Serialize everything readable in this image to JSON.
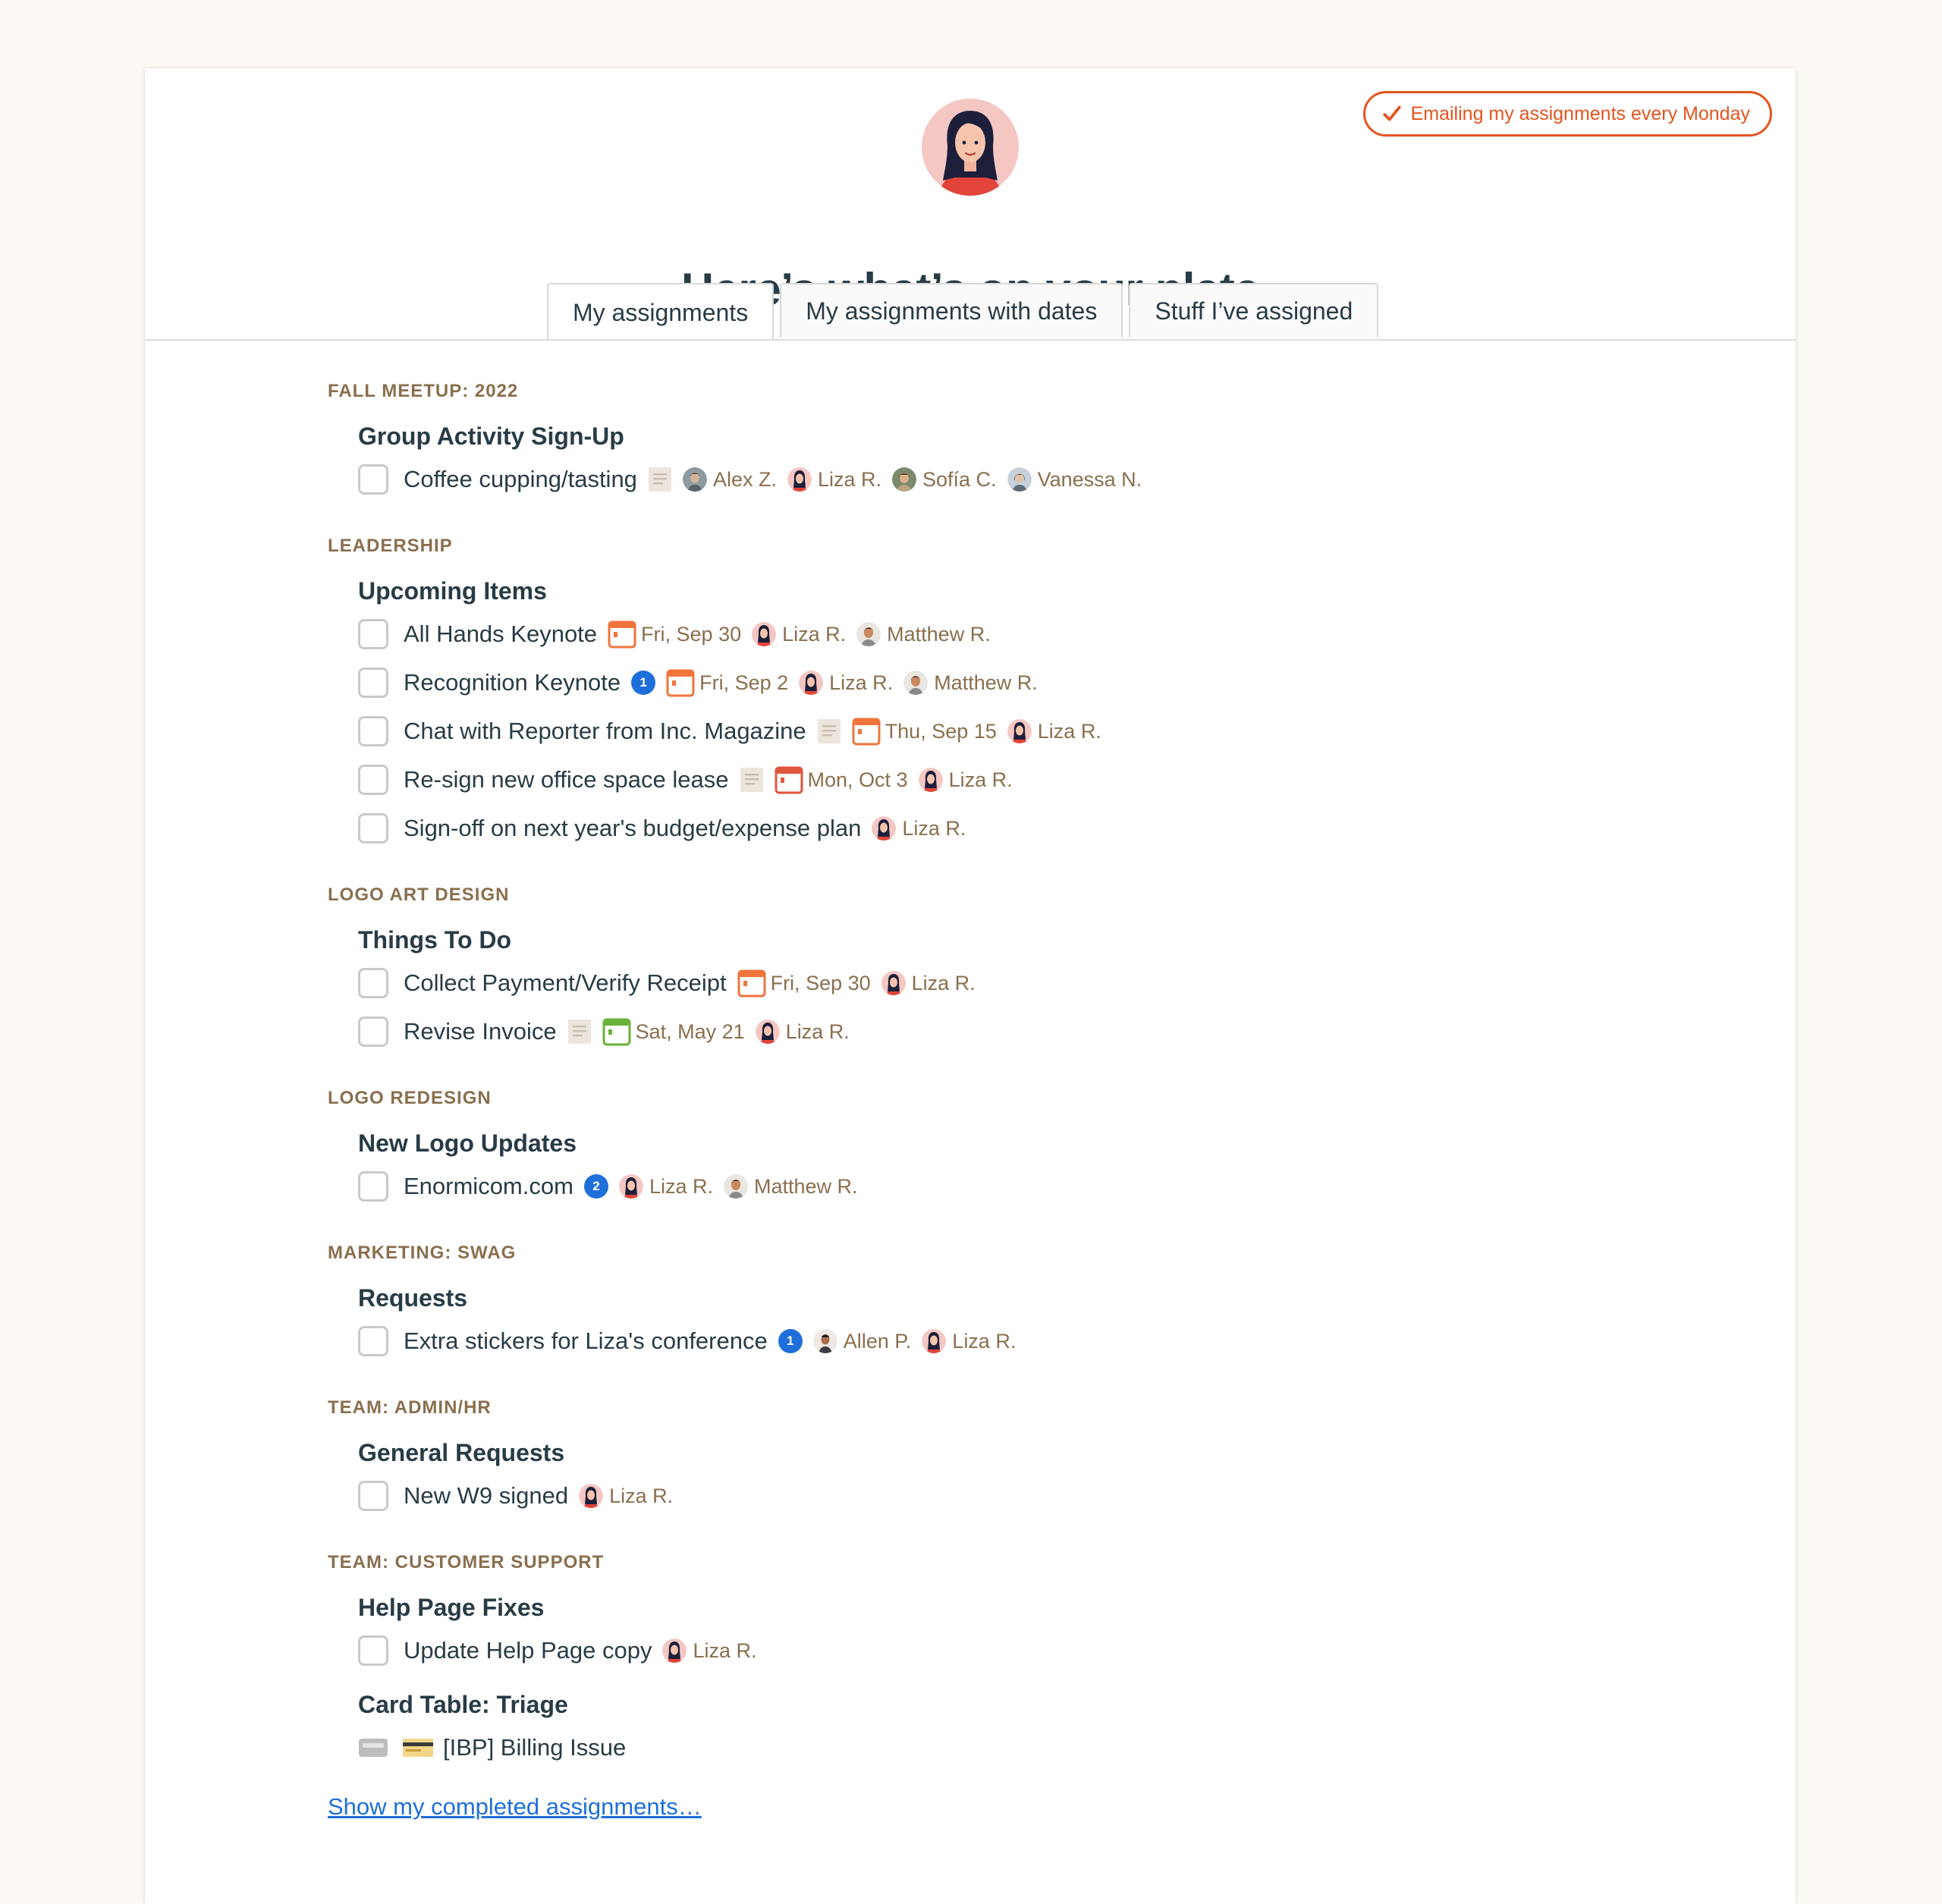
{
  "header": {
    "email_toggle_label": "Emailing my assignments every Monday",
    "title": "Here’s what’s on your plate"
  },
  "tabs": [
    {
      "label": "My assignments",
      "active": true
    },
    {
      "label": "My assignments with dates",
      "active": false
    },
    {
      "label": "Stuff I’ve assigned",
      "active": false
    }
  ],
  "buckets": [
    {
      "name": "FALL MEETUP: 2022",
      "lists": [
        {
          "title": "Group Activity Sign-Up",
          "todos": [
            {
              "title": "Coffee cupping/tasting",
              "note": true,
              "people": [
                "Alex Z.",
                "Liza R.",
                "Sofía C.",
                "Vanessa N."
              ]
            }
          ]
        }
      ]
    },
    {
      "name": "LEADERSHIP",
      "lists": [
        {
          "title": "Upcoming Items",
          "todos": [
            {
              "title": "All Hands Keynote",
              "date": "Fri, Sep 30",
              "date_color": "orange",
              "people": [
                "Liza R.",
                "Matthew R."
              ]
            },
            {
              "title": "Recognition Keynote",
              "comments": "1",
              "date": "Fri, Sep 2",
              "date_color": "orange",
              "people": [
                "Liza R.",
                "Matthew R."
              ]
            },
            {
              "title": "Chat with Reporter from Inc. Magazine",
              "note": true,
              "date": "Thu, Sep 15",
              "date_color": "orange",
              "people": [
                "Liza R."
              ]
            },
            {
              "title": "Re-sign new office space lease",
              "note": true,
              "date": "Mon, Oct 3",
              "date_color": "red",
              "people": [
                "Liza R."
              ]
            },
            {
              "title": "Sign-off on next year's budget/expense plan",
              "people": [
                "Liza R."
              ]
            }
          ]
        }
      ]
    },
    {
      "name": "LOGO ART DESIGN",
      "lists": [
        {
          "title": "Things To Do",
          "todos": [
            {
              "title": "Collect Payment/Verify Receipt",
              "date": "Fri, Sep 30",
              "date_color": "orange",
              "people": [
                "Liza R."
              ]
            },
            {
              "title": "Revise Invoice",
              "note": true,
              "date": "Sat, May 21",
              "date_color": "green",
              "people": [
                "Liza R."
              ]
            }
          ]
        }
      ]
    },
    {
      "name": "LOGO REDESIGN",
      "lists": [
        {
          "title": "New Logo Updates",
          "todos": [
            {
              "title": "Enormicom.com",
              "comments": "2",
              "people": [
                "Liza R.",
                "Matthew R."
              ]
            }
          ]
        }
      ]
    },
    {
      "name": "MARKETING: SWAG",
      "lists": [
        {
          "title": "Requests",
          "todos": [
            {
              "title": "Extra stickers for Liza's conference",
              "comments": "1",
              "people": [
                "Allen P.",
                "Liza R."
              ]
            }
          ]
        }
      ]
    },
    {
      "name": "TEAM: ADMIN/HR",
      "lists": [
        {
          "title": "General Requests",
          "todos": [
            {
              "title": "New W9 signed",
              "people": [
                "Liza R."
              ]
            }
          ]
        }
      ]
    },
    {
      "name": "TEAM: CUSTOMER SUPPORT",
      "lists": [
        {
          "title": "Help Page Fixes",
          "todos": [
            {
              "title": "Update Help Page copy",
              "people": [
                "Liza R."
              ]
            }
          ]
        },
        {
          "title": "Card Table: Triage",
          "cards": [
            {
              "title": "[IBP] Billing Issue"
            }
          ]
        }
      ]
    }
  ],
  "completed_link": "Show my completed assignments…",
  "colors": {
    "accent": "#e5541f",
    "bucket_name": "#8a6f4e",
    "link": "#1e6fd9",
    "title": "#283c46",
    "date_orange": "#f0743c",
    "date_red": "#e0553d",
    "date_green": "#6ab23a"
  }
}
